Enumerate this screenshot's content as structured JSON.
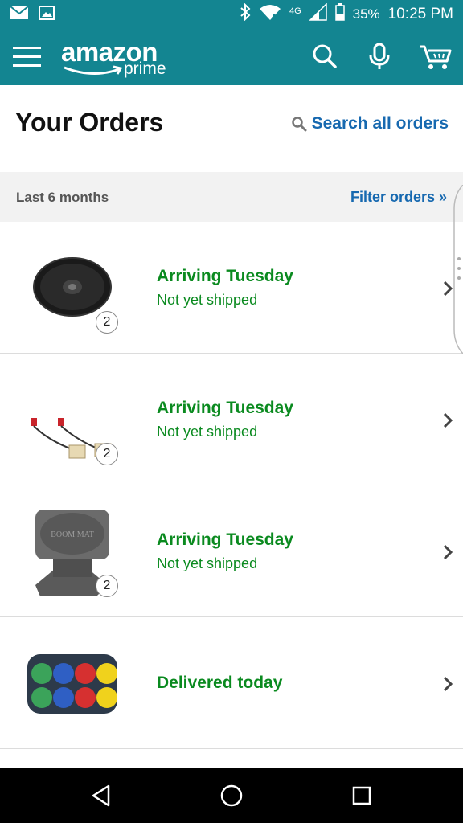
{
  "status_bar": {
    "battery": "35%",
    "time": "10:25 PM",
    "network": "4G",
    "icons": [
      "mail-icon",
      "image-icon",
      "bluetooth-icon",
      "wifi-icon",
      "signal-icon",
      "battery-icon"
    ]
  },
  "header": {
    "logo_word": "amazon",
    "logo_sub": "prime",
    "icons": [
      "menu-icon",
      "search-icon",
      "microphone-icon",
      "cart-icon"
    ]
  },
  "orders_page": {
    "title": "Your Orders",
    "search_label": "Search all orders",
    "period": "Last 6 months",
    "filter_label": "Filter orders »"
  },
  "orders": [
    {
      "status": "Arriving Tuesday",
      "substatus": "Not yet shipped",
      "quantity": "2",
      "image": "car-speaker"
    },
    {
      "status": "Arriving Tuesday",
      "substatus": "Not yet shipped",
      "quantity": "2",
      "image": "speaker-wire-harness"
    },
    {
      "status": "Arriving Tuesday",
      "substatus": "Not yet shipped",
      "quantity": "2",
      "image": "speaker-baffle",
      "image_text": "BOOM MAT"
    },
    {
      "status": "Delivered today",
      "image": "bocce-ball-set"
    }
  ],
  "colors": {
    "brand_teal": "#138591",
    "link_blue": "#1769b0",
    "status_green": "#0a8a1f"
  }
}
